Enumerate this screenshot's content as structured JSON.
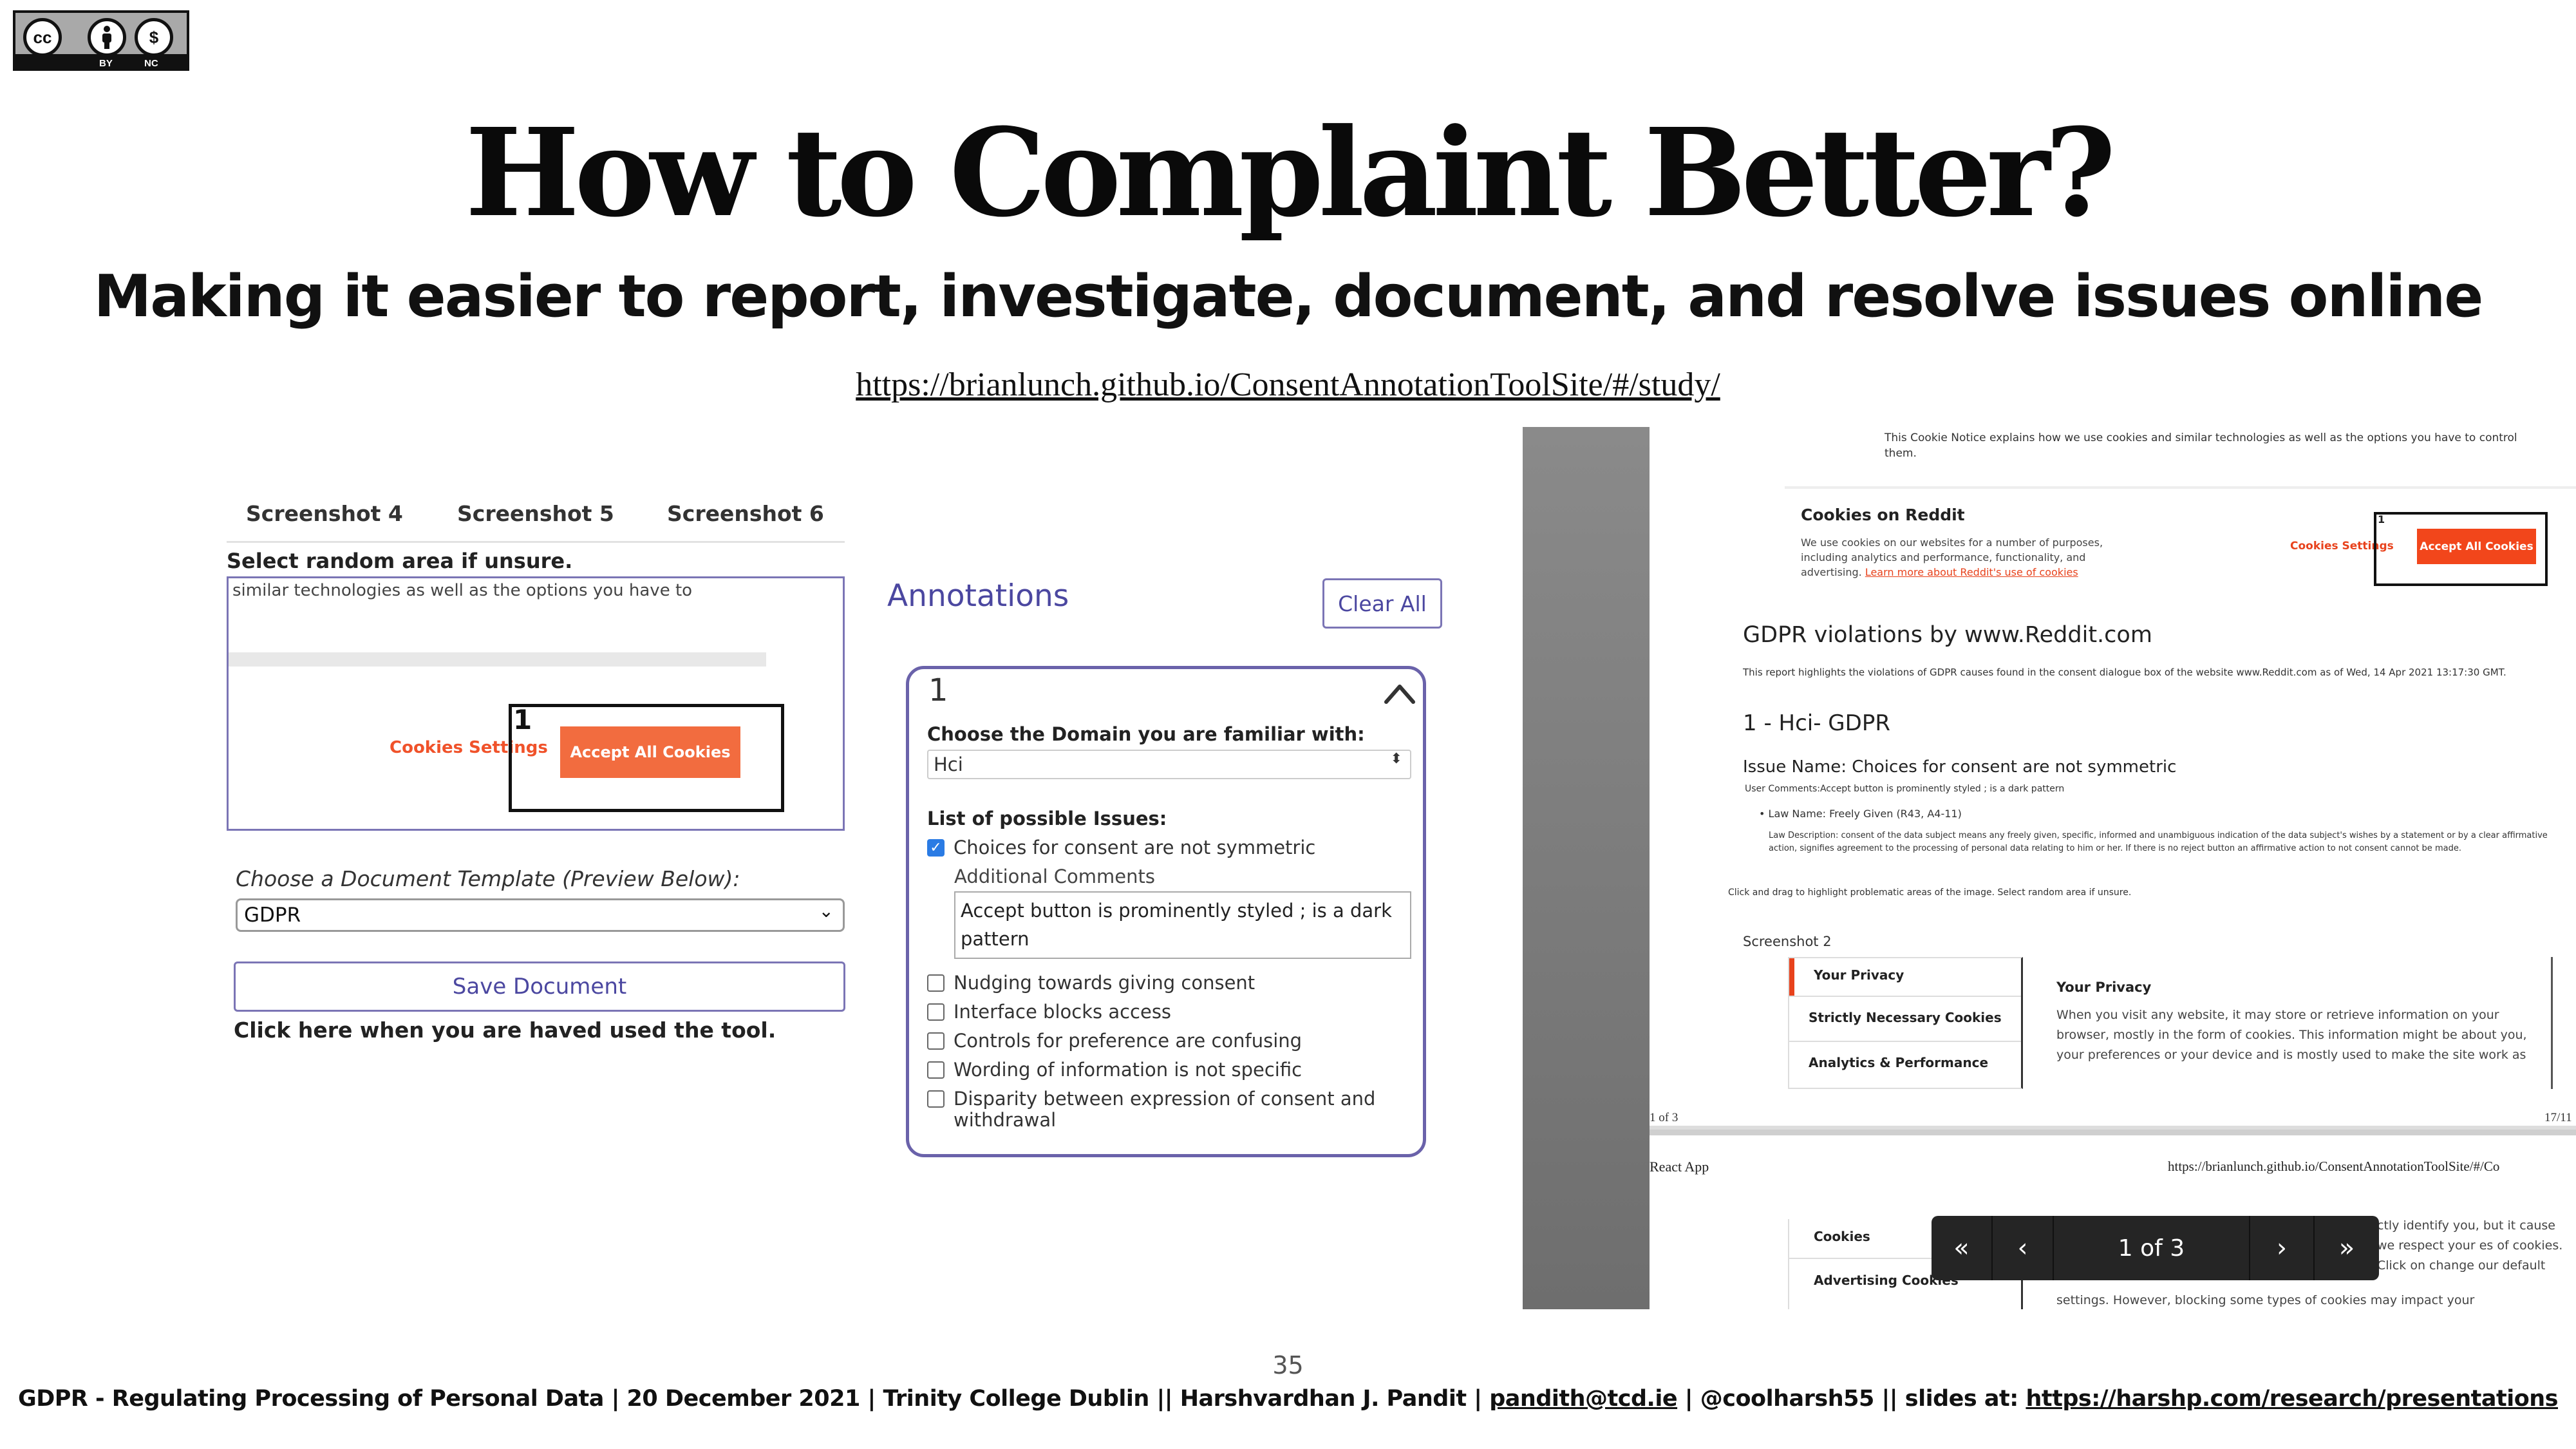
{
  "license_badge": {
    "labels": [
      "BY",
      "NC"
    ],
    "icons": [
      "cc-icon",
      "attribution-icon",
      "noncommercial-icon"
    ]
  },
  "slide": {
    "title": "How to Complaint Better?",
    "subtitle": "Making it easier to report, investigate, document, and resolve issues online",
    "url": "https://brianlunch.github.io/ConsentAnnotationToolSite/#/study/",
    "slide_number": "35"
  },
  "left_screenshot": {
    "tabs": [
      "Screenshot 4",
      "Screenshot 5",
      "Screenshot 6"
    ],
    "select_random": "Select random area if unsure.",
    "preview_text": "similar technologies as well as the options you have to",
    "cookies_settings": "Cookies Settings",
    "accept_all": "Accept All Cookies",
    "annotation_number": "1",
    "template_label": "Choose a Document Template (Preview Below):",
    "template_value": "GDPR",
    "save_button": "Save Document",
    "click_here": "Click here when you are haved used the tool."
  },
  "annotations": {
    "title": "Annotations",
    "clear_all": "Clear All",
    "card": {
      "number": "1",
      "domain_label": "Choose the Domain you are familiar with:",
      "domain_value": "Hci",
      "issues_label": "List of possible Issues:",
      "additional_comments_label": "Additional Comments",
      "comment_text": "Accept button is prominently styled ; is a dark pattern",
      "issues": [
        {
          "label": "Choices for consent are not symmetric",
          "checked": true
        },
        {
          "label": "Nudging towards giving consent",
          "checked": false
        },
        {
          "label": "Interface blocks access",
          "checked": false
        },
        {
          "label": "Controls for preference are confusing",
          "checked": false
        },
        {
          "label": "Wording of information is not specific",
          "checked": false
        },
        {
          "label": "Disparity between expression of consent and",
          "checked": false
        }
      ],
      "issue_continuation": "withdrawal"
    }
  },
  "right_screenshot": {
    "cookie_notice_top": "This Cookie Notice explains how we use cookies and similar technologies as well as the options you have to control them.",
    "cookies_on_reddit": "Cookies on Reddit",
    "cookies_reddit_body": "We use cookies on our websites for a number of purposes, including analytics and performance, functionality, and advertising.",
    "cookies_reddit_link": "Learn more about Reddit's use of cookies",
    "cookies_settings": "Cookies Settings",
    "accept_all": "Accept All Cookies",
    "annotation_number": "1",
    "heading": "GDPR violations by www.Reddit.com",
    "report_line": "This report highlights the violations of GDPR causes found in the consent dialogue box of the website www.Reddit.com as of Wed, 14 Apr 2021 13:17:30 GMT.",
    "section": "1 - Hci- GDPR",
    "issue_name": "Issue Name: Choices for consent are not symmetric",
    "user_comments": "User Comments:Accept button is prominently styled ; is a dark pattern",
    "law_name": "Law Name: Freely Given (R43, A4-11)",
    "law_description": "Law Description: consent of the data subject means any freely given, specific, informed and unambiguous indication of the data subject's wishes by a statement or by a clear affirmative action, signifies agreement to the processing of personal data relating to him or her. If there is no reject button an affirmative action to not consent cannot be made.",
    "click_drag": "Click and drag to highlight problematic areas of the image. Select random area if unsure.",
    "screenshot_2": "Screenshot 2",
    "your_privacy_tab": "Your Privacy",
    "strictly_necessary": "Strictly Necessary Cookies",
    "analytics": "Analytics & Performance",
    "your_privacy_heading": "Your Privacy",
    "privacy_body": "When you visit any website, it may store or retrieve information on your browser, mostly in the form of cookies. This information might be about you, your preferences or your device and is mostly used to make the site work as",
    "page_of": "1 of 3",
    "page_date": "17/11",
    "react_app": "React App",
    "url2": "https://brianlunch.github.io/ConsentAnnotationToolSite/#/Co",
    "cookies_tab2": "Cookies",
    "advertising": "Advertising Cookies",
    "privacy_body2": "ctly identify you, but it cause we respect your es of cookies. Click on change our default",
    "privacy_body2b": "settings. However, blocking some types of cookies may impact your"
  },
  "pager": {
    "first": "«",
    "prev": "‹",
    "label": "1 of 3",
    "next": "›",
    "last": "»"
  },
  "footer": {
    "text_main": "GDPR - Regulating Processing of Personal Data | 20 December 2021 | Trinity College Dublin  || Harshvardhan J. Pandit | ",
    "email": "pandith@tcd.ie",
    "text_mid": " | @coolharsh55  || slides at: ",
    "slides_url": "https://harshp.com/research/presentations"
  }
}
